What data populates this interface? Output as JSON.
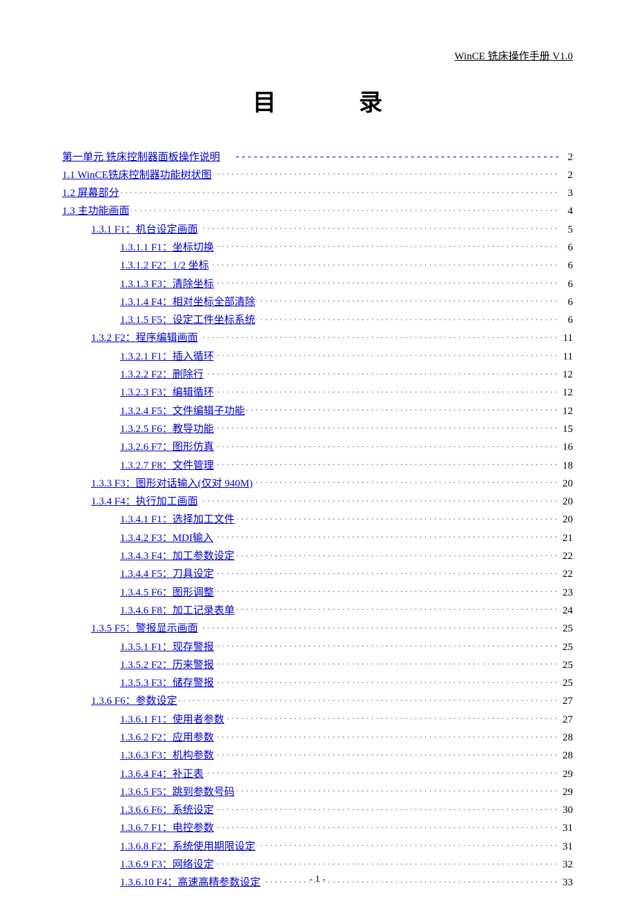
{
  "header": "WinCE 铣床操作手册 V1.0",
  "title_left": "目",
  "title_right": "录",
  "footer": "- 1 -",
  "toc": [
    {
      "indent": 0,
      "label": "第一单元  铣床控制器面板操作说明",
      "leader": "dashes",
      "page": "2"
    },
    {
      "indent": 0,
      "label": "1.1 WinCE铣床控制器功能树状图",
      "leader": "dots",
      "page": "2"
    },
    {
      "indent": 0,
      "label": "1.2 屏幕部分",
      "leader": "dots",
      "page": "3"
    },
    {
      "indent": 0,
      "label": "1.3 主功能画面",
      "leader": "dots",
      "page": "4"
    },
    {
      "indent": 1,
      "label": "1.3.1   F1：机台设定画面",
      "leader": "dots",
      "page": "5"
    },
    {
      "indent": 2,
      "label": "1.3.1.1   F1：坐标切换",
      "leader": "dots",
      "page": "6"
    },
    {
      "indent": 2,
      "label": "1.3.1.2   F2：1/2 坐标",
      "leader": "dots",
      "page": "6"
    },
    {
      "indent": 2,
      "label": "1.3.1.3   F3：清除坐标",
      "leader": "dots",
      "page": "6"
    },
    {
      "indent": 2,
      "label": "1.3.1.4   F4：相对坐标全部清除",
      "leader": "dots",
      "page": "6"
    },
    {
      "indent": 2,
      "label": "1.3.1.5   F5：设定工件坐标系统",
      "leader": "dots",
      "page": "6"
    },
    {
      "indent": 1,
      "label": "1.3.2  F2：程序编辑画面",
      "leader": "dots",
      "page": "11"
    },
    {
      "indent": 2,
      "label": "1.3.2.1   F1：插入循环",
      "leader": "dots",
      "page": "11"
    },
    {
      "indent": 2,
      "label": "1.3.2.2   F2：删除行",
      "leader": "dots",
      "page": "12"
    },
    {
      "indent": 2,
      "label": "1.3.2.3   F3：编辑循环",
      "leader": "dots",
      "page": "12"
    },
    {
      "indent": 2,
      "label": "1.3.2.4   F5：文件编辑子功能",
      "leader": "dots",
      "page": "12"
    },
    {
      "indent": 2,
      "label": "1.3.2.5   F6：教导功能",
      "leader": "dots",
      "page": "15"
    },
    {
      "indent": 2,
      "label": "1.3.2.6   F7：图形仿真",
      "leader": "dots",
      "page": "16"
    },
    {
      "indent": 2,
      "label": "1.3.2.7   F8：文件管理",
      "leader": "dots",
      "page": "18"
    },
    {
      "indent": 1,
      "label": "1.3.3   F3：图形对话输入(仅对 940M)",
      "leader": "dots",
      "page": "20"
    },
    {
      "indent": 1,
      "label": "1.3.4   F4：执行加工画面",
      "leader": "dots",
      "page": "20"
    },
    {
      "indent": 2,
      "label": "1.3.4.1   F1：选择加工文件",
      "leader": "dots",
      "page": "20"
    },
    {
      "indent": 2,
      "label": "1.3.4.2   F3：MDI输入",
      "leader": "dots",
      "page": "21"
    },
    {
      "indent": 2,
      "label": "1.3.4.3   F4：加工参数设定",
      "leader": "dots",
      "page": "22"
    },
    {
      "indent": 2,
      "label": "1.3.4.4   F5：刀具设定",
      "leader": "dots",
      "page": "22"
    },
    {
      "indent": 2,
      "label": "1.3.4.5   F6：图形调整",
      "leader": "dots",
      "page": "23"
    },
    {
      "indent": 2,
      "label": "1.3.4.6   F8：加工记录表单",
      "leader": "dots",
      "page": "24"
    },
    {
      "indent": 1,
      "label": "1.3.5   F5：警报显示画面",
      "leader": "dots",
      "page": "25"
    },
    {
      "indent": 2,
      "label": "1.3.5.1   F1：现存警报",
      "leader": "dots",
      "page": "25"
    },
    {
      "indent": 2,
      "label": "1.3.5.2   F2：历来警报",
      "leader": "dots",
      "page": "25"
    },
    {
      "indent": 2,
      "label": "1.3.5.3   F3：储存警报",
      "leader": "dots",
      "page": "25"
    },
    {
      "indent": 1,
      "label": "1.3.6   F6：参数设定",
      "leader": "dots",
      "page": "27"
    },
    {
      "indent": 2,
      "label": "1.3.6.1    F1：使用者参数",
      "leader": "dots",
      "page": "27"
    },
    {
      "indent": 2,
      "label": "1.3.6.2    F2：应用参数",
      "leader": "dots",
      "page": "28"
    },
    {
      "indent": 2,
      "label": "1.3.6.3    F3：机构参数",
      "leader": "dots",
      "page": "28"
    },
    {
      "indent": 2,
      "label": "1.3.6.4    F4：补正表",
      "leader": "dots",
      "page": "29"
    },
    {
      "indent": 2,
      "label": "1.3.6.5    F5：跳到参数号码",
      "leader": "dots",
      "page": "29"
    },
    {
      "indent": 2,
      "label": "1.3.6.6    F6：系统设定",
      "leader": "dots",
      "page": "30"
    },
    {
      "indent": 2,
      "label": "1.3.6.7    F1：电控参数",
      "leader": "dots",
      "page": "31"
    },
    {
      "indent": 2,
      "label": "1.3.6.8    F2：系统使用期限设定",
      "leader": "dots",
      "page": "31"
    },
    {
      "indent": 2,
      "label": "1.3.6.9    F3：网络设定",
      "leader": "dots",
      "page": "32"
    },
    {
      "indent": 2,
      "label": "1.3.6.10   F4：高速高精参数设定",
      "leader": "dots",
      "page": "33"
    }
  ]
}
